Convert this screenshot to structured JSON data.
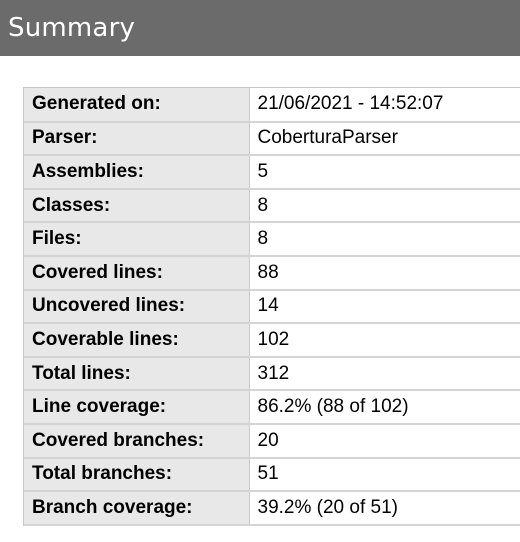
{
  "header": {
    "title": "Summary"
  },
  "summary": {
    "rows": [
      {
        "label": "Generated on:",
        "value": "21/06/2021 - 14:52:07"
      },
      {
        "label": "Parser:",
        "value": "CoberturaParser"
      },
      {
        "label": "Assemblies:",
        "value": "5"
      },
      {
        "label": "Classes:",
        "value": "8"
      },
      {
        "label": "Files:",
        "value": "8"
      },
      {
        "label": "Covered lines:",
        "value": "88"
      },
      {
        "label": "Uncovered lines:",
        "value": "14"
      },
      {
        "label": "Coverable lines:",
        "value": "102"
      },
      {
        "label": "Total lines:",
        "value": "312"
      },
      {
        "label": "Line coverage:",
        "value": "86.2% (88 of 102)"
      },
      {
        "label": "Covered branches:",
        "value": "20"
      },
      {
        "label": "Total branches:",
        "value": "51"
      },
      {
        "label": "Branch coverage:",
        "value": "39.2% (20 of 51)"
      }
    ]
  }
}
